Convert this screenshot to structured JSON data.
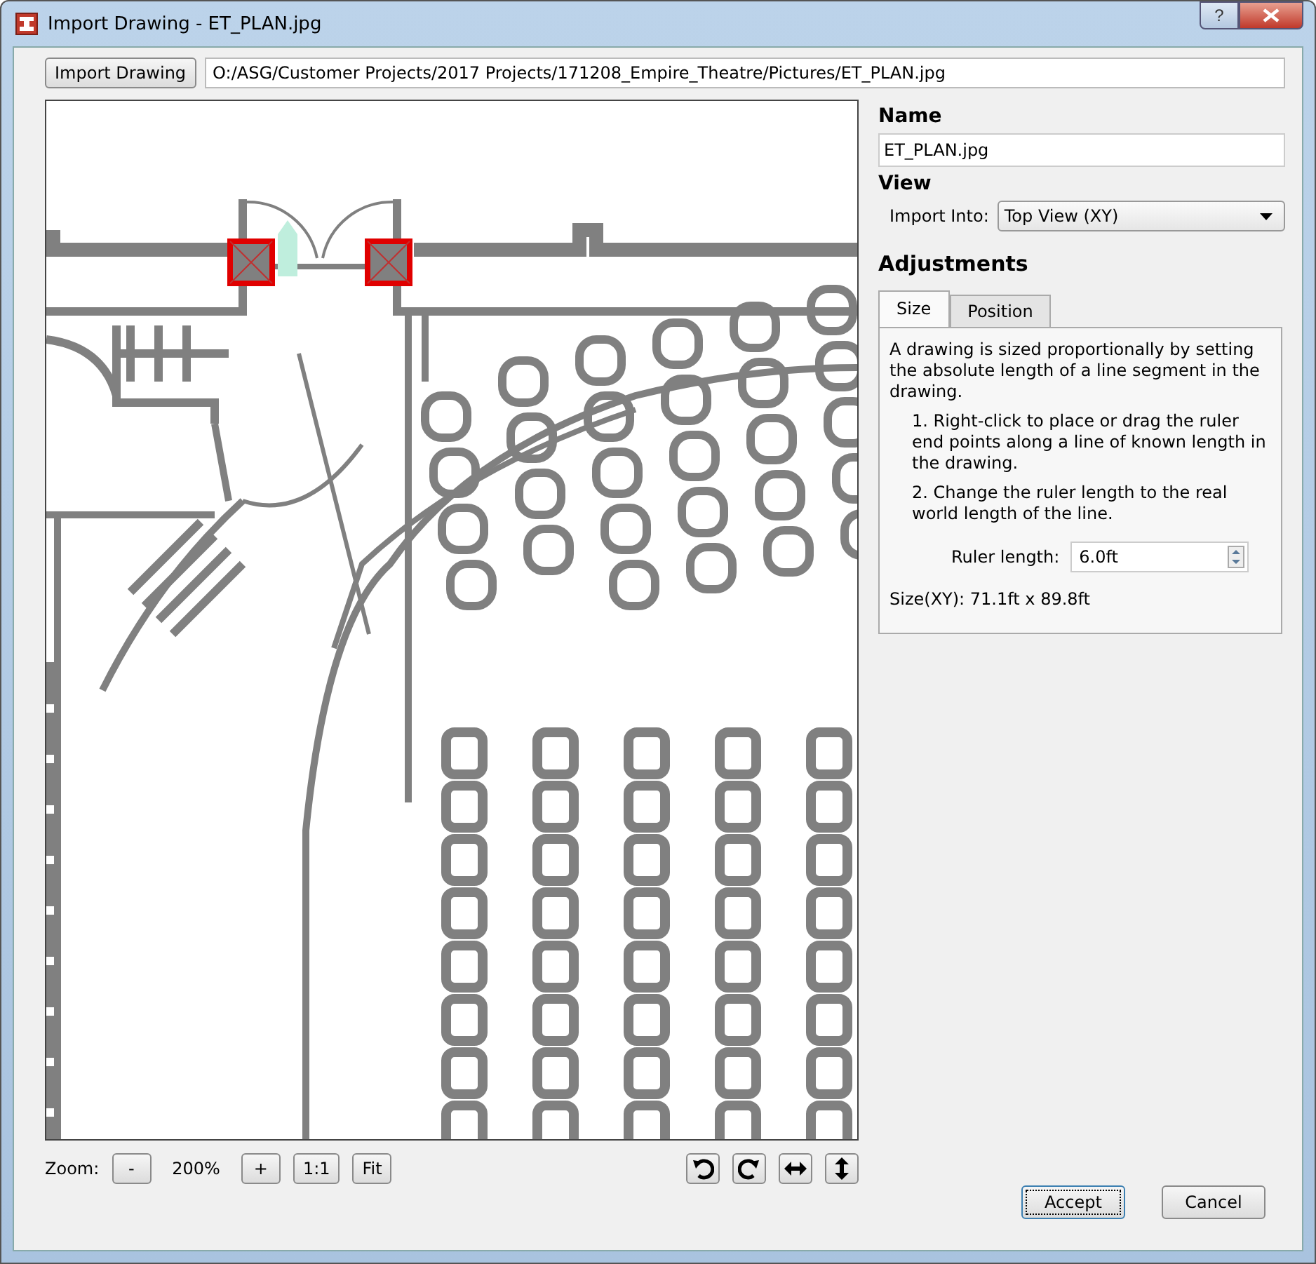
{
  "window": {
    "title": "Import Drawing - ET_PLAN.jpg",
    "help": "?"
  },
  "source": {
    "button": "Import Drawing",
    "path": "O:/ASG/Customer Projects/2017 Projects/171208_Empire_Theatre/Pictures/ET_PLAN.jpg"
  },
  "zoom": {
    "label": "Zoom:",
    "out": "-",
    "value": "200%",
    "in": "+",
    "actual": "1:1",
    "fit": "Fit"
  },
  "name": {
    "heading": "Name",
    "value": "ET_PLAN.jpg"
  },
  "view": {
    "heading": "View",
    "label": "Import Into:",
    "value": "Top View (XY)"
  },
  "adjustments": {
    "heading": "Adjustments",
    "tabs": [
      {
        "label": "Size",
        "selected": true
      },
      {
        "label": "Position",
        "selected": false
      }
    ],
    "intro": "A drawing is sized proportionally by setting the absolute length of a line segment in the drawing.",
    "steps": [
      "1. Right-click to place or drag the ruler end points along a line of known length in the drawing.",
      "2. Change the ruler length to the real world length of the line."
    ],
    "ruler_label": "Ruler length:",
    "ruler_value": "6.0ft",
    "size": "Size(XY): 71.1ft x 89.8ft"
  },
  "buttons": [
    {
      "label": "Accept",
      "focused": true
    },
    {
      "label": "Cancel",
      "focused": false
    }
  ]
}
